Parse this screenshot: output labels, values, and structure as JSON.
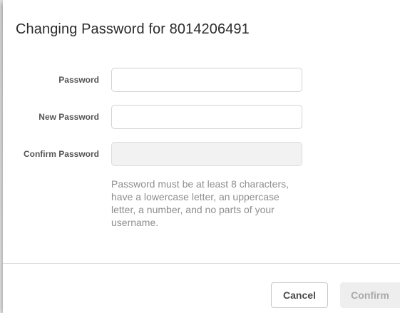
{
  "dialog": {
    "title": "Changing Password for 8014206491",
    "fields": {
      "password": {
        "label": "Password",
        "value": "",
        "placeholder": ""
      },
      "new_password": {
        "label": "New Password",
        "value": "",
        "placeholder": ""
      },
      "confirm_password": {
        "label": "Confirm Password",
        "value": "",
        "placeholder": "",
        "disabled": true
      }
    },
    "hint": "Password must be at least 8 characters, have a lowercase letter, an uppercase letter, a number, and no parts of your username.",
    "buttons": {
      "cancel_label": "Cancel",
      "confirm_label": "Confirm",
      "confirm_disabled": true
    }
  },
  "colors": {
    "title_text": "#2b2b2b",
    "label_text": "#555555",
    "hint_text": "#8e8e8e",
    "input_border": "#d3d3d3",
    "disabled_bg": "#f2f2f2",
    "confirm_disabled_bg": "#eeeeee",
    "confirm_disabled_text": "#a9a9a9"
  }
}
